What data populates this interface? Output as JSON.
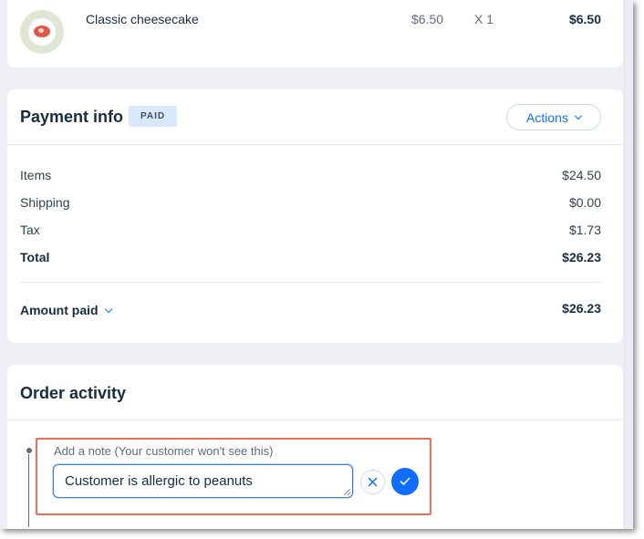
{
  "product": {
    "name": "Classic cheesecake",
    "price": "$6.50",
    "quantity": "X 1",
    "total": "$6.50"
  },
  "payment": {
    "title": "Payment info",
    "status_badge": "PAID",
    "actions_label": "Actions",
    "rows": [
      {
        "label": "Items",
        "value": "$24.50"
      },
      {
        "label": "Shipping",
        "value": "$0.00"
      },
      {
        "label": "Tax",
        "value": "$1.73"
      },
      {
        "label": "Total",
        "value": "$26.23"
      }
    ],
    "amount_paid_label": "Amount paid",
    "amount_paid_value": "$26.23"
  },
  "activity": {
    "title": "Order activity",
    "note_label": "Add a note (Your customer won't see this)",
    "note_value": "Customer is allergic to peanuts"
  },
  "colors": {
    "accent": "#116dff",
    "highlight": "#ee6e55",
    "badge_bg": "#dbe9fe"
  },
  "icons": {
    "cancel": "close-icon",
    "confirm": "checkmark-icon",
    "expand": "chevron-down-icon"
  }
}
